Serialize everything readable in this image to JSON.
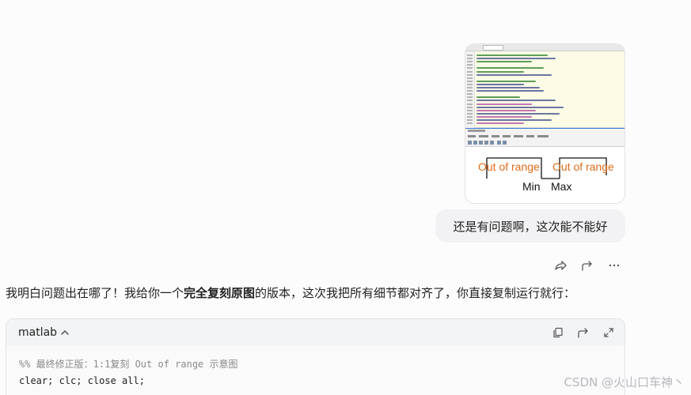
{
  "thumbnail": {
    "plot_labels": {
      "left": "Out of range",
      "right": "Out of range",
      "min": "Min",
      "max": "Max"
    },
    "colors": {
      "range_text": "#e06c1b",
      "axis_text": "#111111"
    }
  },
  "user_message": {
    "text": "还是有问题啊，这次能不能好"
  },
  "actions": {
    "icons": [
      "share-icon",
      "forward-icon",
      "more-icon"
    ]
  },
  "reply": {
    "prefix": "我明白问题出在哪了！我给你一个",
    "bold": "完全复刻原图",
    "suffix": "的版本，这次我把所有细节都对齐了，你直接复制运行就行："
  },
  "code_block": {
    "language": "matlab",
    "lines": [
      "%% 最终修正版：1:1复刻 Out of range 示意图",
      "clear; clc; close all;"
    ]
  },
  "watermark": "CSDN @火山口车神丶"
}
